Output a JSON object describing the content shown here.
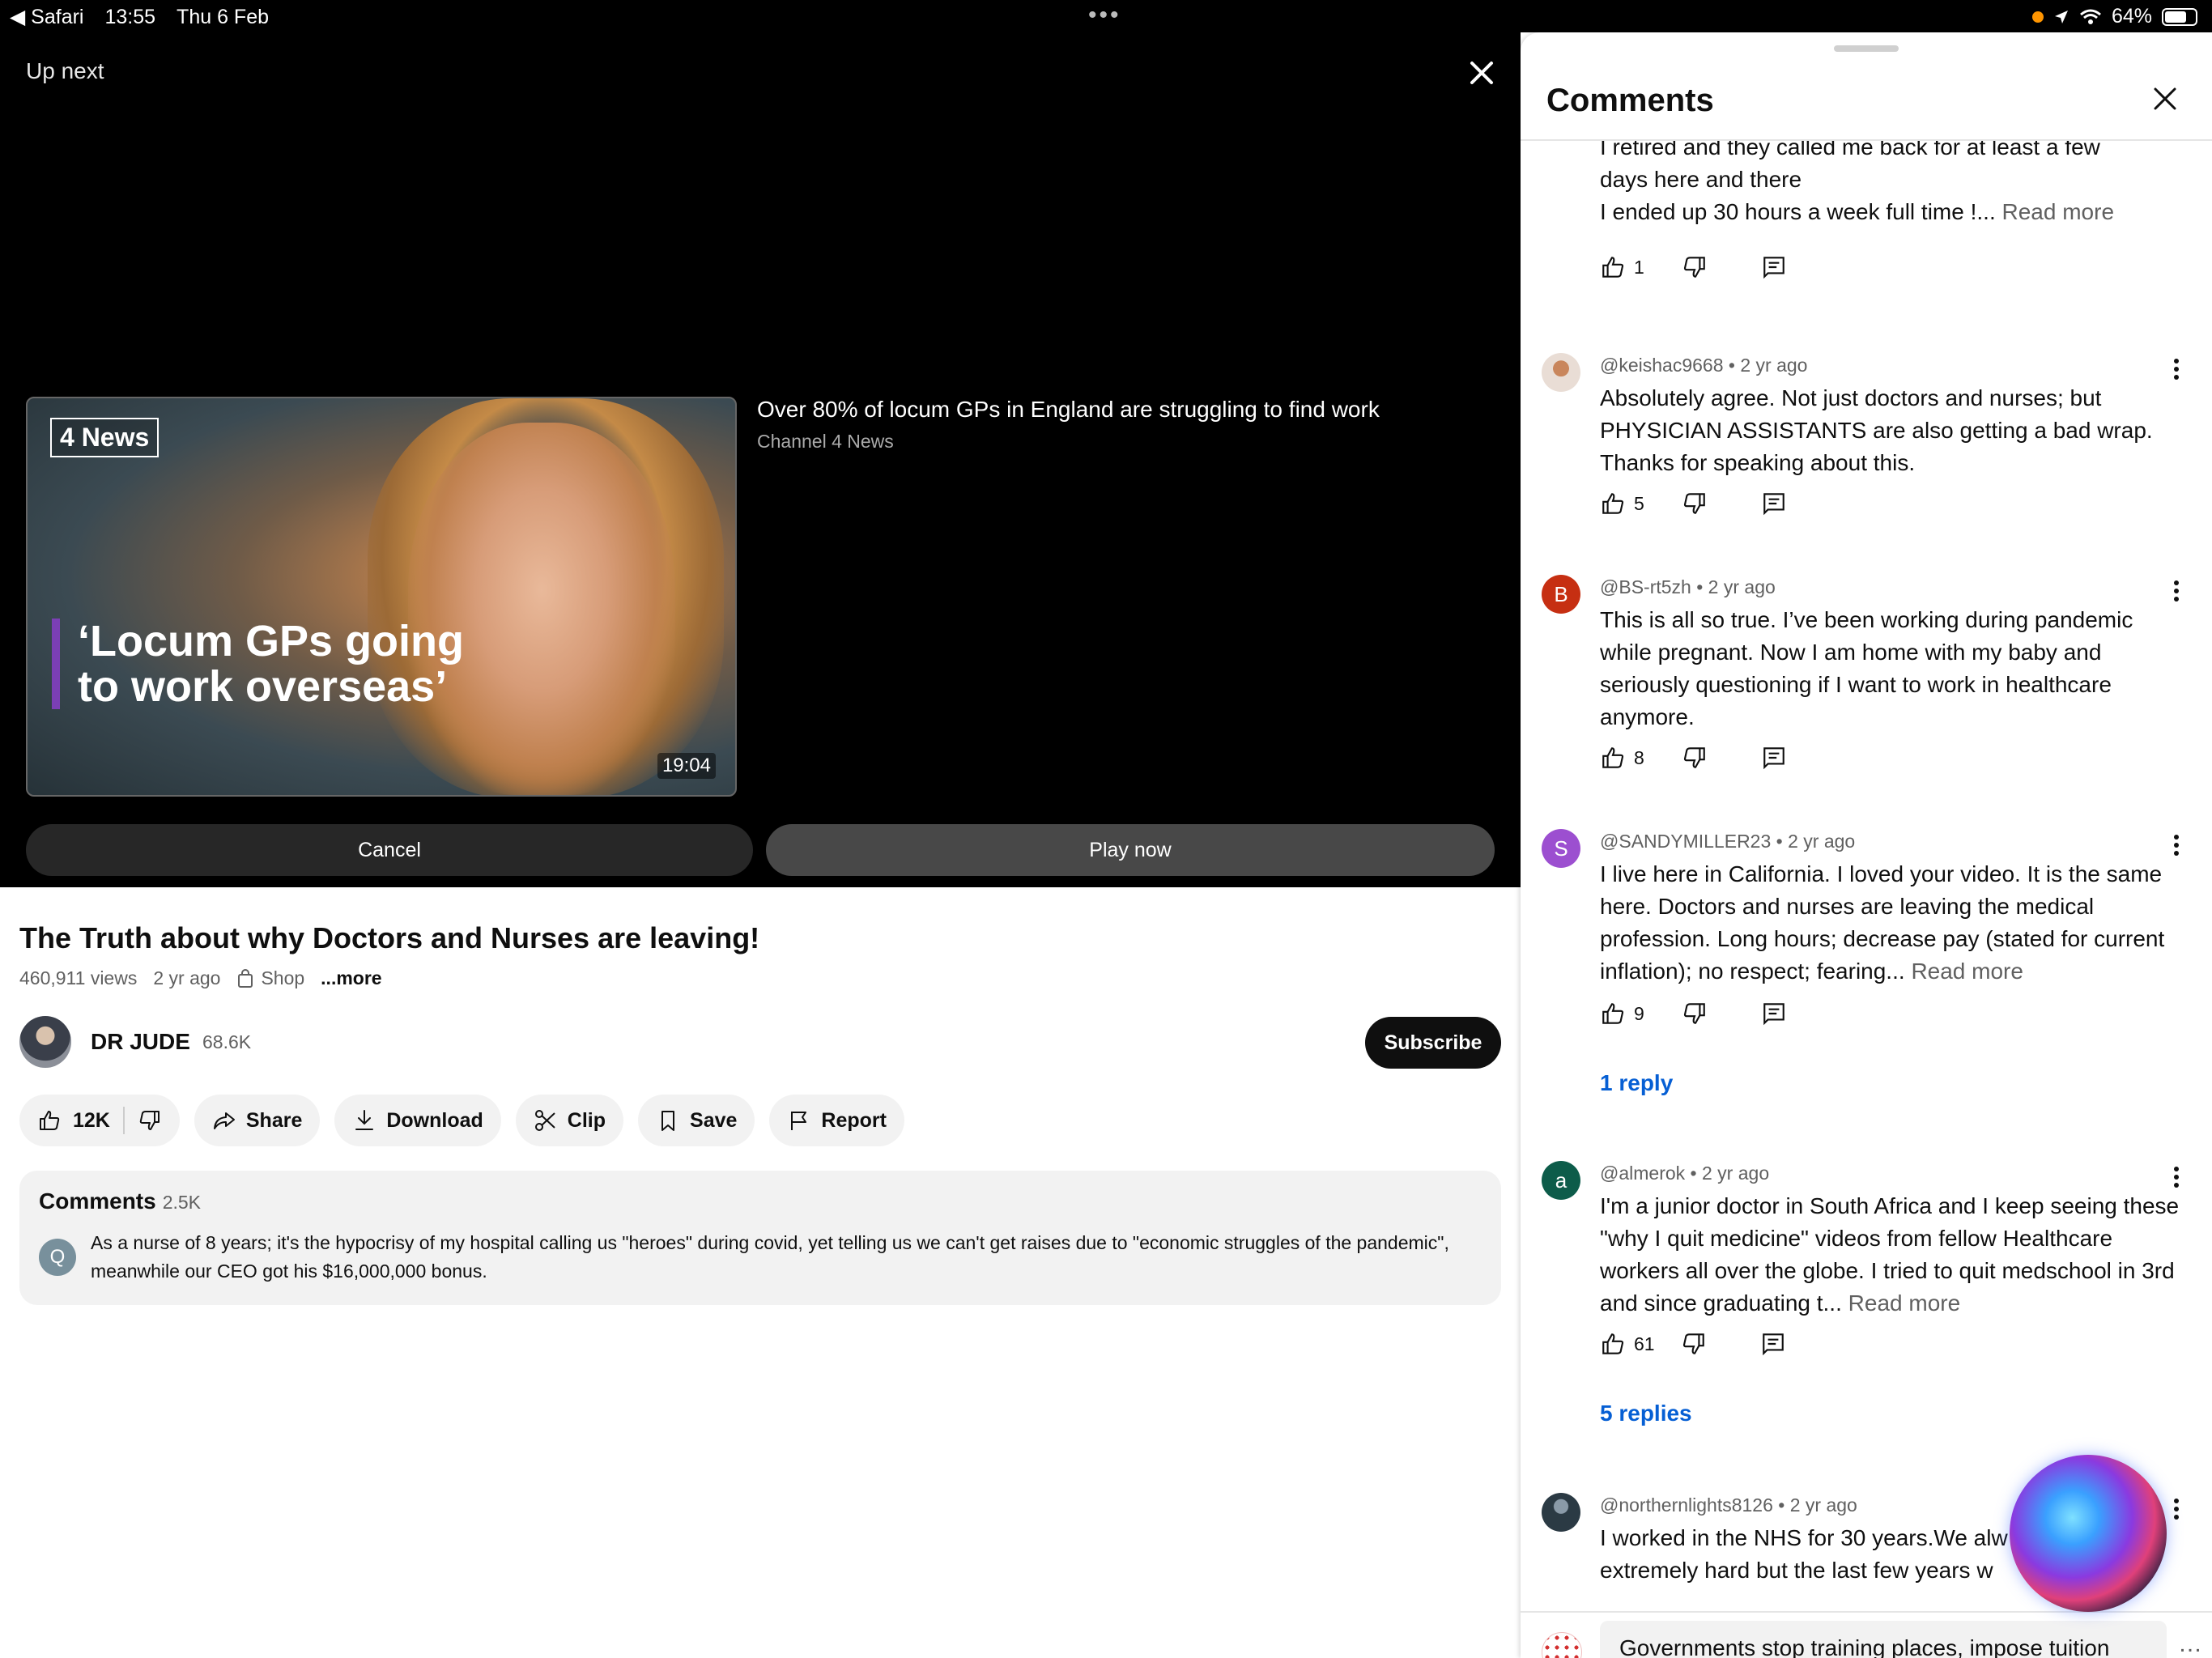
{
  "status_bar": {
    "back_app": "Safari",
    "time": "13:55",
    "date": "Thu 6 Feb",
    "battery": "64%"
  },
  "player": {
    "up_next_label": "Up next",
    "next_video": {
      "title": "Over 80% of locum GPs in England are struggling to find work",
      "channel": "Channel 4 News",
      "duration": "19:04",
      "thumbnail_logo": "News",
      "thumbnail_headline": "‘Locum GPs going to work overseas’"
    },
    "cancel_label": "Cancel",
    "play_now_label": "Play now"
  },
  "video": {
    "title": "The Truth about why Doctors and Nurses are leaving!",
    "views": "460,911 views",
    "age": "2 yr ago",
    "shop_label": "Shop",
    "more_label": "...more"
  },
  "channel": {
    "name": "DR JUDE",
    "subscribers": "68.6K",
    "subscribe_label": "Subscribe"
  },
  "actions": {
    "likes": "12K",
    "share": "Share",
    "download": "Download",
    "clip": "Clip",
    "save": "Save",
    "report": "Report"
  },
  "comments_preview": {
    "label": "Comments",
    "count": "2.5K",
    "avatar_letter": "Q",
    "text": "As a nurse of 8 years; it's the hypocrisy of my hospital calling us \"heroes\" during covid, yet telling us we can't get raises due to \"economic struggles of the pandemic\", meanwhile our CEO got his $16,000,000 bonus."
  },
  "panel": {
    "title": "Comments",
    "comments": [
      {
        "text_lines": [
          "I retired and they called me back for at least a few",
          "days here and there",
          "I ended up 30 hours a week full time !..."
        ],
        "read_more": "Read more",
        "likes": "1"
      },
      {
        "author": "@keishac9668",
        "age": "2 yr ago",
        "text": "Absolutely agree. Not just doctors and nurses; but PHYSICIAN ASSISTANTS  are also getting a bad wrap. Thanks for speaking about this.",
        "likes": "5"
      },
      {
        "author": "@BS-rt5zh",
        "age": "2 yr ago",
        "avatar_letter": "B",
        "avatar_color": "#c62f12",
        "text": "This is all so true. I’ve been working during pandemic while pregnant. Now I am home with my baby and seriously questioning if I want to work in healthcare anymore.",
        "likes": "8"
      },
      {
        "author": "@SANDYMILLER23",
        "age": "2 yr ago",
        "avatar_letter": "S",
        "avatar_color": "#9c4fd0",
        "text": "I live here in California. I loved your video. It is the same here. Doctors and nurses are leaving the medical profession. Long hours; decrease pay (stated for current inflation); no respect; fearing...",
        "read_more": "Read more",
        "likes": "9",
        "replies": "1 reply"
      },
      {
        "author": "@almerok",
        "age": "2 yr ago",
        "avatar_letter": "a",
        "avatar_color": "#0d5c4a",
        "text": "I'm a junior doctor in South Africa and I keep seeing these \"why I quit medicine\" videos from fellow Healthcare workers all over the globe. I tried to quit medschool in 3rd and since graduating t...",
        "read_more": "Read more",
        "likes": "61",
        "replies": "5 replies"
      },
      {
        "author": "@northernlights8126",
        "age": "2 yr ago",
        "text_lines": [
          "I worked in the NHS for 30 years.We alw",
          "extremely hard but the last few years w"
        ]
      }
    ],
    "input_text": "Governments stop training places, impose tuition"
  },
  "colors": {
    "accent_link": "#065fd4",
    "player_bg": "#000000",
    "pill_bg": "#f2f2f2"
  }
}
